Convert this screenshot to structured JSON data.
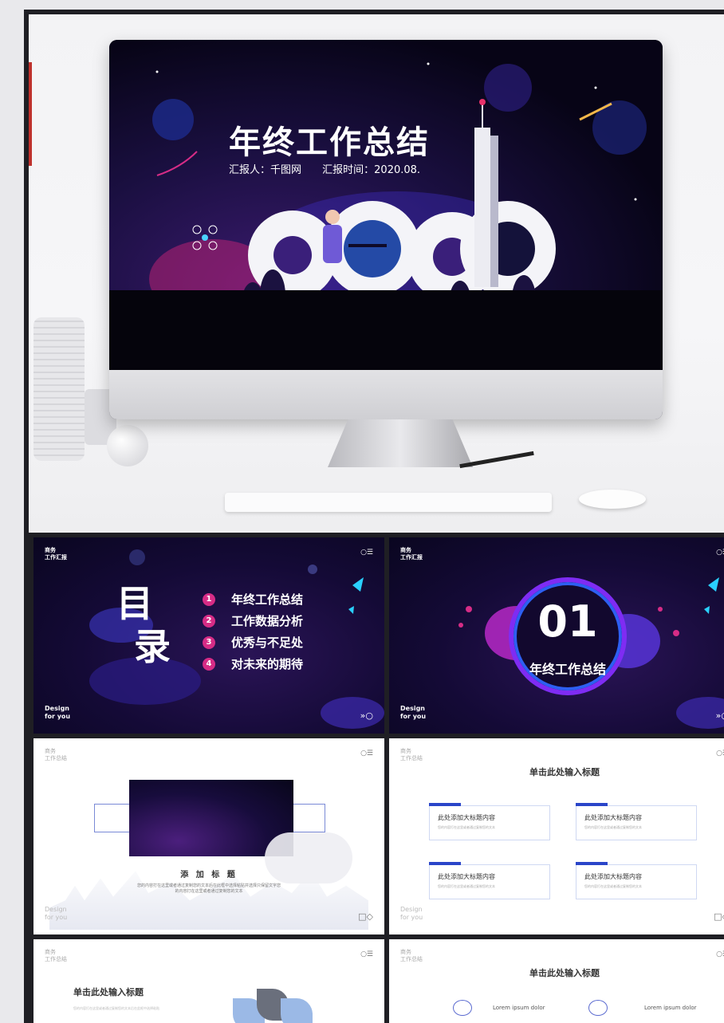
{
  "hero": {
    "title": "年终工作总结",
    "reporter": "汇报人：千图网",
    "report_time": "汇报时间：2020.08."
  },
  "slides": {
    "corner_label": "商务\n工作汇报",
    "light_corner_label": "商务\n工作总结",
    "design_label": "Design\nfor you",
    "menu_icon": "○☰",
    "next_icon": "»○",
    "square_icon": "□◇",
    "toc": {
      "title_1": "目",
      "title_2": "录",
      "items": [
        {
          "num": "1",
          "text": "年终工作总结"
        },
        {
          "num": "2",
          "text": "工作数据分析"
        },
        {
          "num": "3",
          "text": "优秀与不足处"
        },
        {
          "num": "4",
          "text": "对未来的期待"
        }
      ]
    },
    "section": {
      "number": "01",
      "title": "年终工作总结"
    },
    "add_title": {
      "title": "添 加 标 题",
      "text": "您的内容打在这里或者通过复制您的文本后在此框中选择粘贴并选择只保留文字您的内容打在这里或者通过复制您的文本"
    },
    "cards": {
      "title": "单击此处输入标题",
      "items": [
        {
          "heading": "此处添加大标题内容",
          "text": "您的内容打在这里或者通过复制您的文本"
        },
        {
          "heading": "此处添加大标题内容",
          "text": "您的内容打在这里或者通过复制您的文本"
        },
        {
          "heading": "此处添加大标题内容",
          "text": "您的内容打在这里或者通过复制您的文本"
        },
        {
          "heading": "此处添加大标题内容",
          "text": "您的内容打在这里或者通过复制您的文本"
        }
      ]
    },
    "bottom_left": {
      "title": "单击此处输入标题",
      "text": "您的内容打在这里或者通过复制您的文本后在此框中选择粘贴"
    },
    "bottom_right": {
      "title": "单击此处输入标题",
      "item_1": "Lorem ipsum dolor",
      "item_2": "Lorem ipsum dolor"
    }
  },
  "colors": {
    "accent_magenta": "#d62c86",
    "accent_blue": "#2a45c9",
    "dark_bg": "#140a36"
  }
}
